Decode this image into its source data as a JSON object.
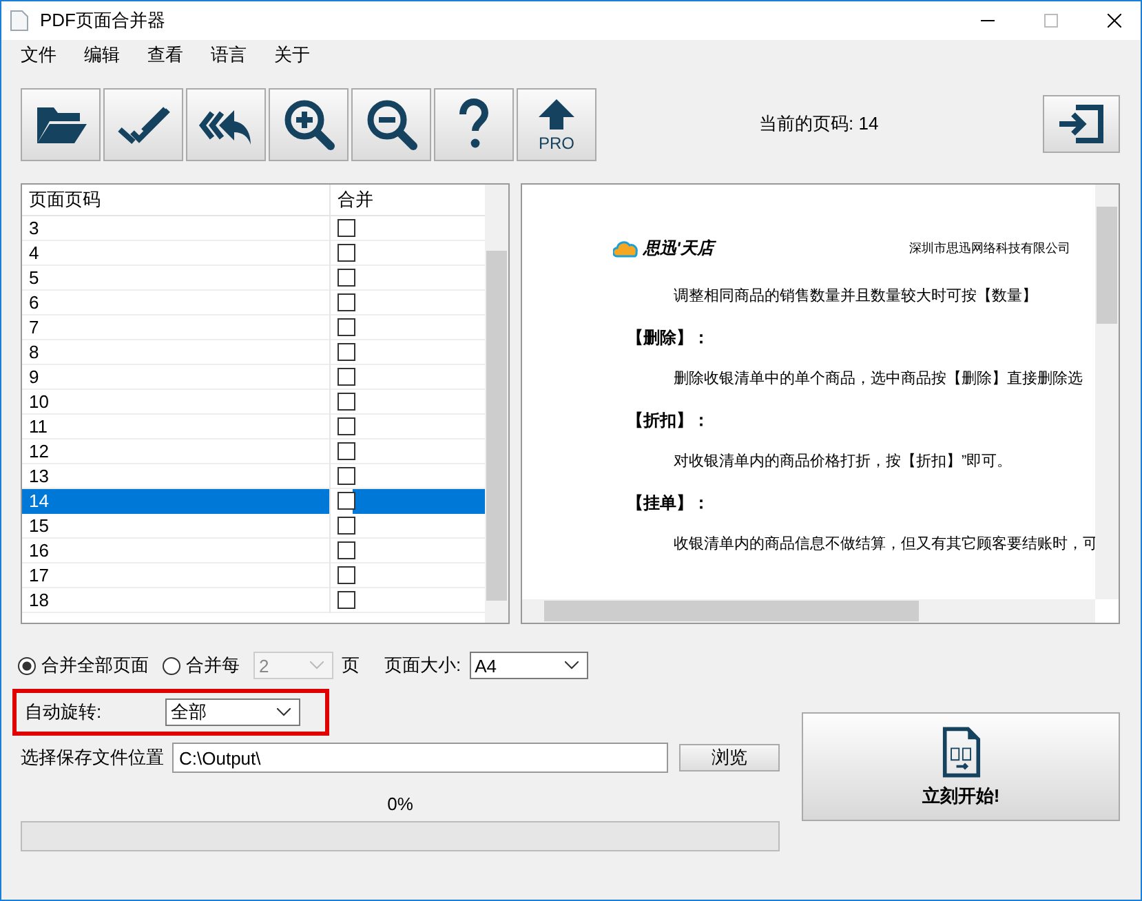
{
  "window": {
    "title": "PDF页面合并器"
  },
  "menu": [
    "文件",
    "编辑",
    "查看",
    "语言",
    "关于"
  ],
  "toolbar": [
    {
      "kind": "open"
    },
    {
      "kind": "check"
    },
    {
      "kind": "undo"
    },
    {
      "kind": "zoom-in"
    },
    {
      "kind": "zoom-out"
    },
    {
      "kind": "help"
    },
    {
      "kind": "pro",
      "label": "PRO"
    }
  ],
  "current_page": "当前的页码: 14",
  "list": {
    "columns": [
      "页面页码",
      "合并"
    ],
    "rows": [
      {
        "page": "3",
        "checked": false,
        "selected": false
      },
      {
        "page": "4",
        "checked": false,
        "selected": false
      },
      {
        "page": "5",
        "checked": false,
        "selected": false
      },
      {
        "page": "6",
        "checked": false,
        "selected": false
      },
      {
        "page": "7",
        "checked": false,
        "selected": false
      },
      {
        "page": "8",
        "checked": false,
        "selected": false
      },
      {
        "page": "9",
        "checked": false,
        "selected": false
      },
      {
        "page": "10",
        "checked": false,
        "selected": false
      },
      {
        "page": "11",
        "checked": false,
        "selected": false
      },
      {
        "page": "12",
        "checked": false,
        "selected": false
      },
      {
        "page": "13",
        "checked": false,
        "selected": false
      },
      {
        "page": "14",
        "checked": false,
        "selected": true
      },
      {
        "page": "15",
        "checked": false,
        "selected": false
      },
      {
        "page": "16",
        "checked": false,
        "selected": false
      },
      {
        "page": "17",
        "checked": false,
        "selected": false
      },
      {
        "page": "18",
        "checked": false,
        "selected": false
      }
    ]
  },
  "preview": {
    "logo": "思迅'天店",
    "company": "深圳市思迅网络科技有限公司",
    "lines": [
      {
        "kind": "body",
        "text": "调整相同商品的销售数量并且数量较大时可按【数量】"
      },
      {
        "kind": "heading",
        "text": "【删除】："
      },
      {
        "kind": "body",
        "text": "删除收银清单中的单个商品，选中商品按【删除】直接删除选"
      },
      {
        "kind": "heading",
        "text": "【折扣】："
      },
      {
        "kind": "body",
        "text": "对收银清单内的商品价格打折，按【折扣】”即可。"
      },
      {
        "kind": "heading",
        "text": "【挂单】："
      },
      {
        "kind": "body",
        "text": "收银清单内的商品信息不做结算，但又有其它顾客要结账时，可"
      }
    ]
  },
  "merge_mode": [
    {
      "label": "合并全部页面",
      "selected": true
    },
    {
      "label": "合并每",
      "selected": false
    }
  ],
  "every_count": "2",
  "every_unit": "页",
  "page_size_label": "页面大小:",
  "page_size": "A4",
  "rotate_label": "自动旋转:",
  "rotate": "全部",
  "save_label": "选择保存文件位置",
  "save_path": "C:\\Output\\",
  "browse": "浏览",
  "progress": {
    "text": "0%",
    "level": 0
  },
  "start": "立刻开始!"
}
